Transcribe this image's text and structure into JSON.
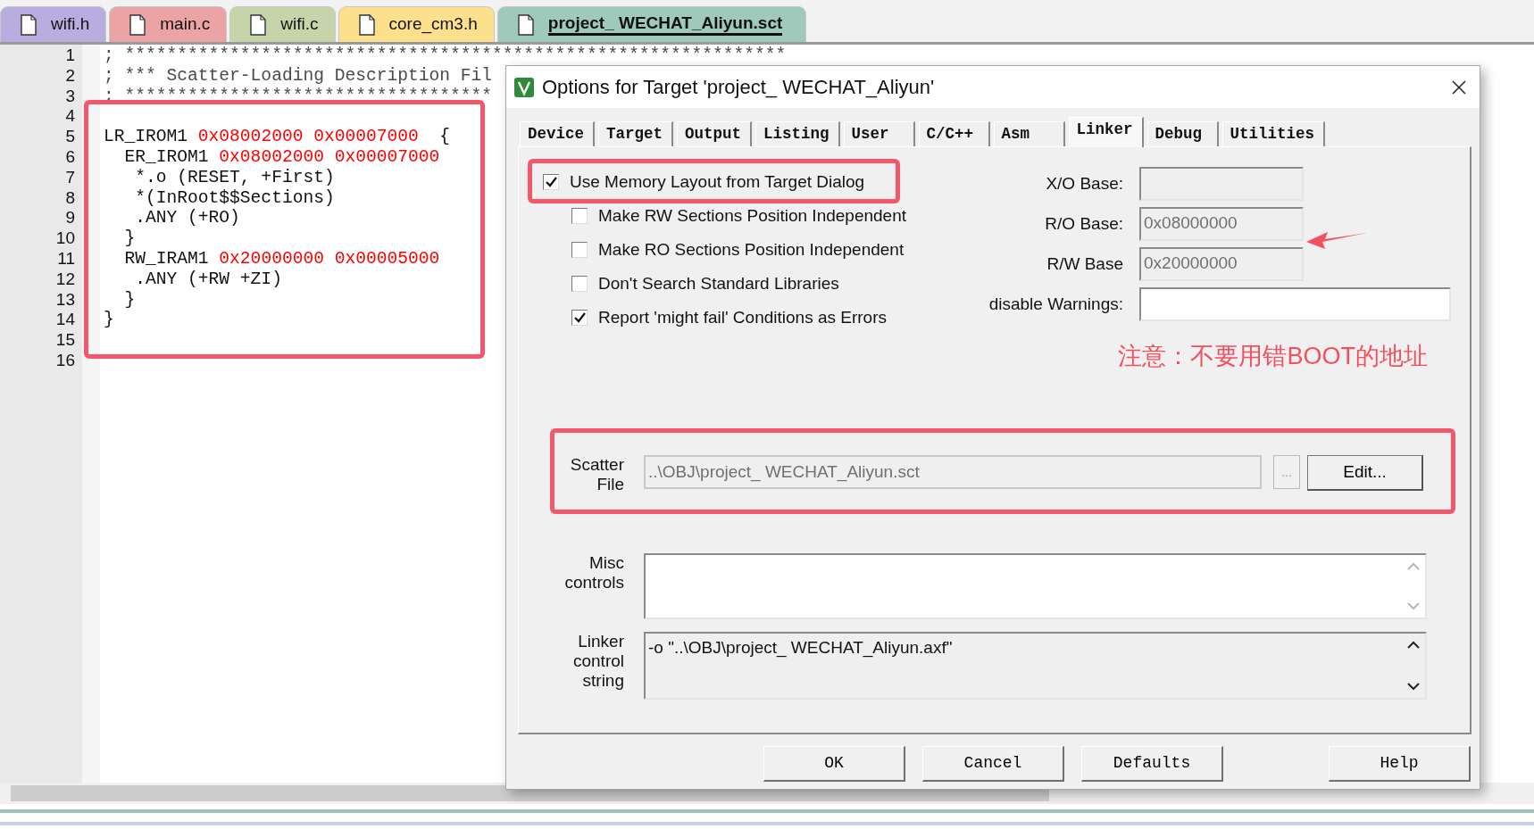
{
  "editor_tabs": [
    {
      "label": "wifi.h",
      "selected": false,
      "color": "#b9acdf"
    },
    {
      "label": "main.c",
      "selected": false,
      "color": "#eba3a3"
    },
    {
      "label": "wifi.c",
      "selected": false,
      "color": "#c6d5a9"
    },
    {
      "label": "core_cm3.h",
      "selected": false,
      "color": "#fde08c"
    },
    {
      "label": "project_ WECHAT_Aliyun.sct",
      "selected": true,
      "color": "#9fc9ba"
    }
  ],
  "code_lines": [
    {
      "number": "1",
      "segments": [
        {
          "kind": "comment",
          "text": "; ***************************************************************"
        }
      ]
    },
    {
      "number": "2",
      "segments": [
        {
          "kind": "comment",
          "text": "; *** Scatter-Loading Description Fil"
        }
      ]
    },
    {
      "number": "3",
      "segments": [
        {
          "kind": "comment",
          "text": "; ***********************************"
        }
      ]
    },
    {
      "number": "4"
    },
    {
      "number": "5",
      "segments": [
        {
          "kind": "code",
          "text": "LR_IROM1 "
        },
        {
          "kind": "hex",
          "text": "0x08002000 0x00007000"
        },
        {
          "kind": "code",
          "text": "  {"
        }
      ]
    },
    {
      "number": "6",
      "segments": [
        {
          "kind": "code",
          "text": "  ER_IROM1 "
        },
        {
          "kind": "hex",
          "text": "0x08002000 0x00007000"
        }
      ]
    },
    {
      "number": "7",
      "segments": [
        {
          "kind": "code",
          "text": "   *.o (RESET, +First)"
        }
      ]
    },
    {
      "number": "8",
      "segments": [
        {
          "kind": "code",
          "text": "   *(InRoot$$Sections)"
        }
      ]
    },
    {
      "number": "9",
      "segments": [
        {
          "kind": "code",
          "text": "   .ANY (+RO)"
        }
      ]
    },
    {
      "number": "10",
      "segments": [
        {
          "kind": "code",
          "text": "  }"
        }
      ]
    },
    {
      "number": "11",
      "segments": [
        {
          "kind": "code",
          "text": "  RW_IRAM1 "
        },
        {
          "kind": "hex",
          "text": "0x20000000 0x00005000"
        }
      ]
    },
    {
      "number": "12",
      "segments": [
        {
          "kind": "code",
          "text": "   .ANY (+RW +ZI)"
        }
      ]
    },
    {
      "number": "13",
      "segments": [
        {
          "kind": "code",
          "text": "  }"
        }
      ]
    },
    {
      "number": "14",
      "segments": [
        {
          "kind": "code",
          "text": "}"
        }
      ]
    },
    {
      "number": "15"
    },
    {
      "number": "16"
    }
  ],
  "dialog": {
    "title": "Options for Target 'project_ WECHAT_Aliyun'",
    "tabs": [
      {
        "label": "Device",
        "selected": false
      },
      {
        "label": "Target",
        "selected": false
      },
      {
        "label": "Output",
        "selected": false
      },
      {
        "label": "Listing",
        "selected": false
      },
      {
        "label": "User",
        "selected": false
      },
      {
        "label": "C/C++",
        "selected": false
      },
      {
        "label": "Asm",
        "selected": false
      },
      {
        "label": "Linker",
        "selected": true
      },
      {
        "label": "Debug",
        "selected": false
      },
      {
        "label": "Utilities",
        "selected": false
      }
    ],
    "memory_layout": {
      "label": "Use Memory Layout from Target Dialog",
      "checked": true
    },
    "options": [
      {
        "label": "Make RW Sections Position Independent",
        "checked": false
      },
      {
        "label": "Make RO Sections Position Independent",
        "checked": false
      },
      {
        "label": "Don't Search Standard Libraries",
        "checked": false
      },
      {
        "label": "Report 'might fail' Conditions as Errors",
        "checked": true
      }
    ],
    "base_fields": [
      {
        "label": "X/O Base:",
        "disabled": true,
        "wide": false
      },
      {
        "label": "R/O Base:",
        "value": "0x08000000",
        "disabled": true,
        "wide": false
      },
      {
        "label": "R/W Base",
        "value": "0x20000000",
        "disabled": true,
        "wide": false
      },
      {
        "label": "disable Warnings:",
        "disabled": false,
        "wide": true
      }
    ],
    "note": "注意：不要用错BOOT的地址",
    "scatter_file": {
      "label": "Scatter File",
      "value": "..\\OBJ\\project_ WECHAT_Aliyun.sct",
      "browse_button": {
        "label": "...",
        "disabled": true
      },
      "edit_button": "Edit..."
    },
    "text_areas": [
      {
        "label": "Misc controls",
        "read_only": false
      },
      {
        "label": "Linker control string",
        "value": "-o \"..\\OBJ\\project_ WECHAT_Aliyun.axf\"",
        "read_only": true
      }
    ],
    "buttons": [
      "OK",
      "Cancel",
      "Defaults",
      "Help"
    ]
  }
}
